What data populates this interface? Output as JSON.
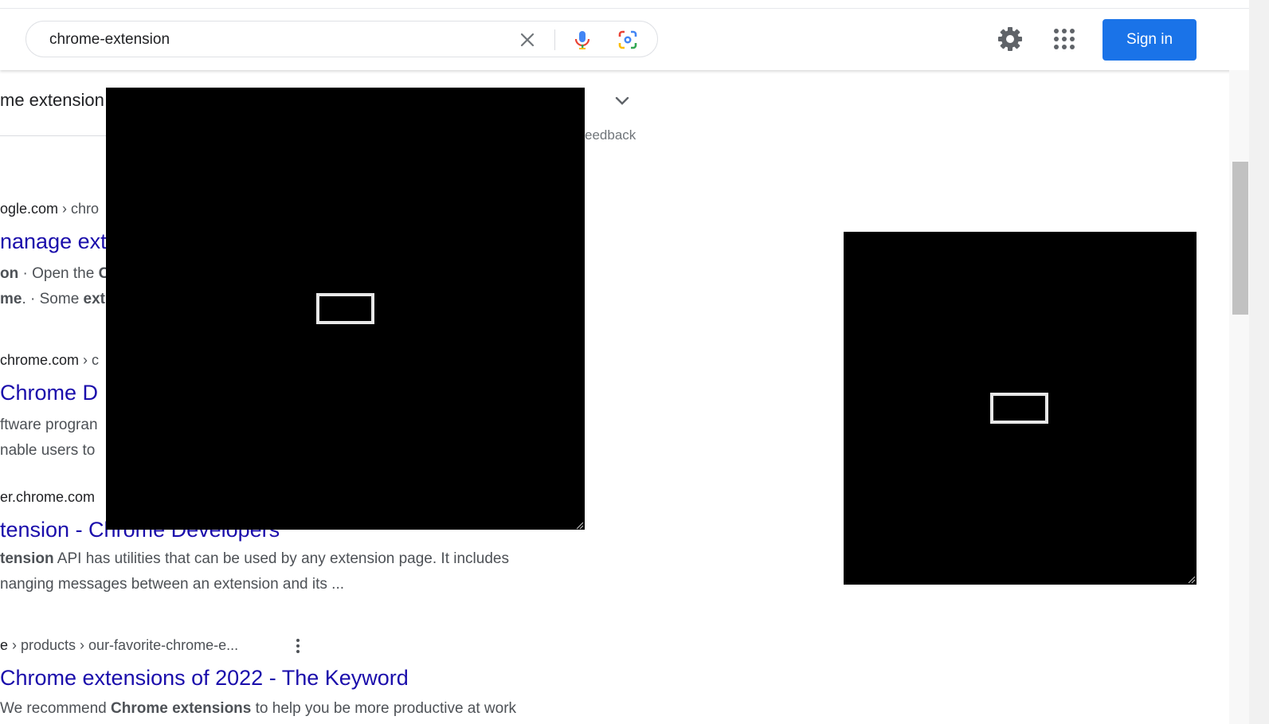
{
  "search": {
    "value": "chrome-extension",
    "clear_icon": "close-icon",
    "voice_icon": "mic-icon",
    "lens_icon": "camera-lens-icon"
  },
  "header": {
    "settings_icon": "gear-icon",
    "apps_icon": "apps-grid-icon",
    "signin_label": "Sign in"
  },
  "snippet": {
    "title": "me extension",
    "feedback_label": "eedback"
  },
  "results": [
    {
      "url_site": "ogle.com",
      "url_crumb": " › chro",
      "title": "nanage ext",
      "line1_bold": "on",
      "line1_text": " · Open the ",
      "line1_bold2": "C",
      "line2_bold": "me",
      "line2_text": ". · Some ",
      "line2_bold2": "ext"
    },
    {
      "url_site": "chrome.com",
      "url_crumb": " › c",
      "title": " Chrome D",
      "line1_text": "ftware progran",
      "line2_text": "nable users to"
    },
    {
      "url_site": "er.chrome.com",
      "title": "tension - Chrome Developers",
      "line1_bold": "tension",
      "line1_text": " API has utilities that can be used by any extension page. It includes",
      "line2_text": "nanging messages between an extension and its ..."
    },
    {
      "url_site": "e",
      "url_crumb": " › products › our-favorite-chrome-e...",
      "title": "Chrome extensions of 2022 - The Keyword",
      "line1_text_pre": "We recommend ",
      "line1_bold": "Chrome extensions",
      "line1_text": " to help you be more productive at work"
    }
  ],
  "colors": {
    "link": "#1a0dab",
    "accent": "#1a73e8",
    "overlay": "#000000"
  }
}
